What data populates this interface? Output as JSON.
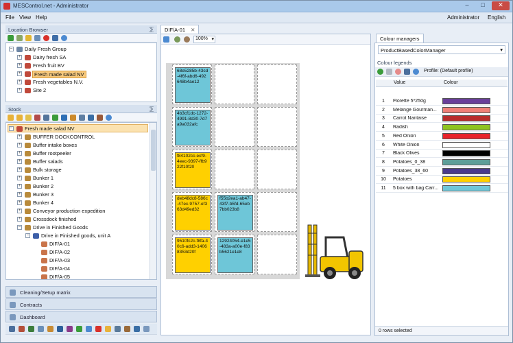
{
  "window": {
    "title": "MESControl.net - Administrator",
    "min": "–",
    "max": "□",
    "close": "✕"
  },
  "menu": {
    "items": [
      "File",
      "View",
      "Help"
    ],
    "user": "Administrator",
    "language": "English"
  },
  "location_browser": {
    "title": "Location Browser",
    "pin": "⅀",
    "items": [
      {
        "label": "Daily Fresh Group",
        "expander": "–"
      },
      {
        "label": "Dairy fresh SA",
        "expander": "+"
      },
      {
        "label": "Fresh fruit BV",
        "expander": "+"
      },
      {
        "label": "Fresh made salad NV",
        "expander": "+"
      },
      {
        "label": "Fresh vegetables N.V.",
        "expander": "+"
      },
      {
        "label": "Site 2",
        "expander": "+"
      }
    ]
  },
  "stock": {
    "title": "Stock",
    "pin": "⅀",
    "items": [
      {
        "label": "Fresh made salad NV",
        "expander": "–"
      },
      {
        "label": "BUFFER DOCKCONTROL",
        "expander": "+"
      },
      {
        "label": "Buffer intake boxes",
        "expander": "+"
      },
      {
        "label": "Buffer rootpeeler",
        "expander": "+"
      },
      {
        "label": "Buffer salads",
        "expander": "+"
      },
      {
        "label": "Bulk storage",
        "expander": "+"
      },
      {
        "label": "Bunker 1",
        "expander": "+"
      },
      {
        "label": "Bunker 2",
        "expander": "+"
      },
      {
        "label": "Bunker 3",
        "expander": "+"
      },
      {
        "label": "Bunker 4",
        "expander": "+"
      },
      {
        "label": "Conveyor production expedition",
        "expander": "+"
      },
      {
        "label": "Crossdock finished",
        "expander": "+"
      },
      {
        "label": "Drive in Finished Goods",
        "expander": "–"
      },
      {
        "label": "Drive in Finished goods, unit A",
        "expander": "–"
      },
      {
        "label": "DIF/A-01",
        "expander": ""
      },
      {
        "label": "DIF/A-02",
        "expander": ""
      },
      {
        "label": "DIF/A-03",
        "expander": ""
      },
      {
        "label": "DIF/A-04",
        "expander": ""
      },
      {
        "label": "DIF/A-05",
        "expander": ""
      }
    ]
  },
  "accordion": [
    "Cleaning/Setup matrix",
    "Contracts",
    "Dashboard"
  ],
  "document_tab": {
    "label": "DIF/A-01",
    "close": "✕"
  },
  "zoom": {
    "value": "100%",
    "arrow": "▾"
  },
  "cards": [
    {
      "text": "68e5285b-43cd-4f6f-abd6-492648b4ae12",
      "color": "#6ec6d8"
    },
    {
      "text": "4b3cf1dc-1272-4991-8d30-7d7a9a032afc",
      "color": "#6ec6d8"
    },
    {
      "text": "f84102cc-ecf9-4eec-9397-ffb922f10f20",
      "color": "#ffd000"
    },
    {
      "text": "deb48dc8-586c-47ec-9757-ef363d49ed32",
      "color": "#ffd000"
    },
    {
      "text": "f55b2ea1-ab47-43f7-b5fd-65eb7bb023b8",
      "color": "#6ec6d8"
    },
    {
      "text": "9510fc2c-f8fa-40c6-add3-14068353d20f",
      "color": "#ffd000"
    },
    {
      "text": "12924054-e1e5-483a-a00e-f83b5621e1e8",
      "color": "#6ec6d8"
    }
  ],
  "colour_managers": {
    "tab_label": "Colour managers",
    "selected": "ProductBasedColorManager",
    "arrow": "▾",
    "legends_title": "Colour legends",
    "profile": "Profile: (Default profile)",
    "columns": [
      "Value",
      "Colour"
    ],
    "rows": [
      {
        "num": "1",
        "value": "Florette 5*250g",
        "color": "#6a3f9a"
      },
      {
        "num": "2",
        "value": "Melange Gourman...",
        "color": "#f08078"
      },
      {
        "num": "3",
        "value": "Carrot Nantaise",
        "color": "#b82d2d"
      },
      {
        "num": "4",
        "value": "Radish",
        "color": "#8ec31f"
      },
      {
        "num": "5",
        "value": "Red Onion",
        "color": "#e8232a"
      },
      {
        "num": "6",
        "value": "White Onion",
        "color": "#ffffff"
      },
      {
        "num": "7",
        "value": "Black Olives",
        "color": "#000000"
      },
      {
        "num": "8",
        "value": "Potatoes_0_38",
        "color": "#5d9e98"
      },
      {
        "num": "9",
        "value": "Potatoes_38_60",
        "color": "#4a3a8c"
      },
      {
        "num": "10",
        "value": "Potatoes",
        "color": "#ffd000"
      },
      {
        "num": "11",
        "value": "5 box with bag Carr...",
        "color": "#6ec6d8"
      }
    ],
    "status": "0 rows selected"
  }
}
